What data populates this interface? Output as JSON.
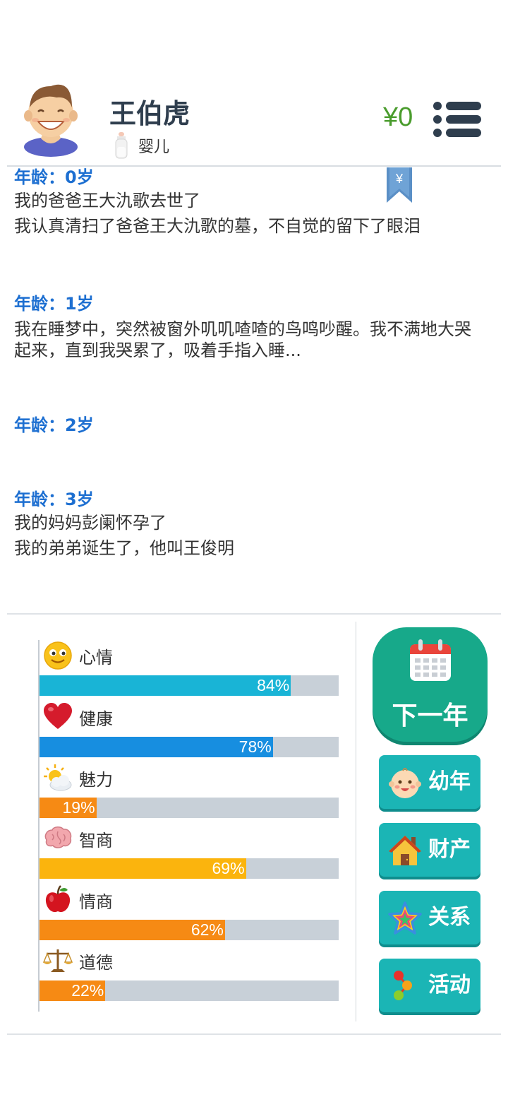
{
  "profile": {
    "name": "王伯虎",
    "stage_icon": "baby-bottle-icon",
    "stage": "婴儿",
    "money": "¥0"
  },
  "bookmark": {
    "icon": "yen-bookmark-icon",
    "symbol": "¥"
  },
  "log": [
    {
      "age": "年龄：0岁",
      "lines": [
        "我的爸爸王大氿歌去世了",
        "我认真清扫了爸爸王大氿歌的墓，不自觉的留下了眼泪"
      ]
    },
    {
      "age": "年龄：1岁",
      "lines": [
        "我在睡梦中，突然被窗外叽叽喳喳的鸟鸣吵醒。我不满地大哭起来，直到我哭累了，吸着手指入睡..."
      ]
    },
    {
      "age": "年龄：2岁",
      "lines": []
    },
    {
      "age": "年龄：3岁",
      "lines": [
        "我的妈妈彭阑怀孕了",
        "我的弟弟诞生了，他叫王俊明"
      ]
    }
  ],
  "stats": [
    {
      "label": "心情",
      "icon": "smiley-icon",
      "value": 84,
      "text": "84%",
      "color": "#19b4d6"
    },
    {
      "label": "健康",
      "icon": "heart-icon",
      "value": 78,
      "text": "78%",
      "color": "#178ee0"
    },
    {
      "label": "魅力",
      "icon": "sun-cloud-icon",
      "value": 19,
      "text": "19%",
      "color": "#f68a14"
    },
    {
      "label": "智商",
      "icon": "brain-icon",
      "value": 69,
      "text": "69%",
      "color": "#fbb40d"
    },
    {
      "label": "情商",
      "icon": "apple-icon",
      "value": 62,
      "text": "62%",
      "color": "#f68a14"
    },
    {
      "label": "道德",
      "icon": "scales-icon",
      "value": 22,
      "text": "22%",
      "color": "#f68a14"
    }
  ],
  "actions": {
    "next_year": "下一年",
    "childhood": "幼年",
    "assets": "财产",
    "relations": "关系",
    "activities": "活动"
  },
  "colors": {
    "accent": "#17a98a",
    "side_button": "#1bb5b5",
    "age_text": "#1d6fd1",
    "money": "#4a9c2d"
  }
}
